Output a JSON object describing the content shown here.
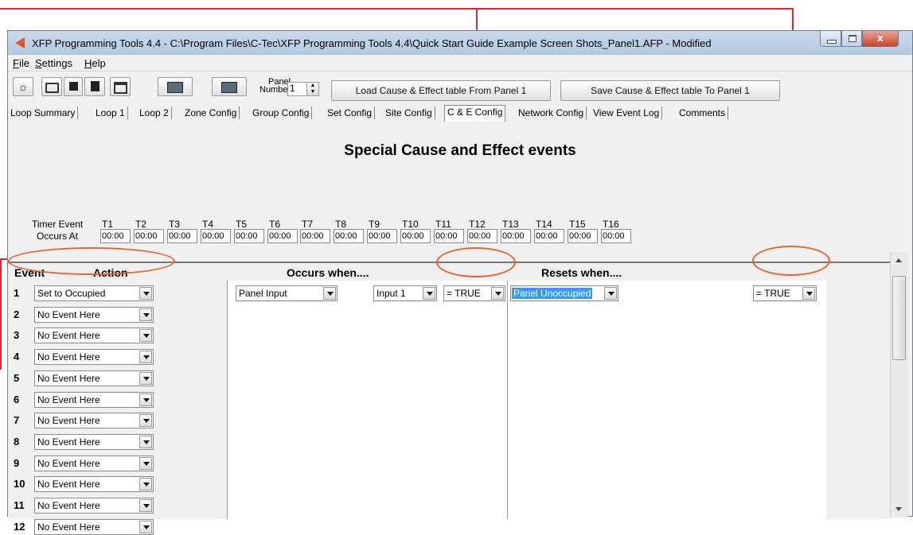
{
  "window": {
    "title": "XFP Programming Tools 4.4 - C:\\Program Files\\C-Tec\\XFP Programming Tools 4.4\\Quick Start Guide Example Screen Shots_Panel1.AFP - Modified",
    "close_glyph": "x"
  },
  "menu": [
    "File",
    "Settings",
    "Help"
  ],
  "toolbar": {
    "panel_label_line1": "Panel",
    "panel_label_line2": "Number",
    "panel_number": "1",
    "load_label": "Load Cause & Effect table From Panel 1",
    "save_label": "Save Cause & Effect table To Panel 1"
  },
  "tabs": [
    "Loop Summary",
    "Loop 1",
    "Loop 2",
    "Zone Config",
    "Group Config",
    "Set Config",
    "Site Config",
    "C & E Config",
    "Network Config",
    "View Event Log",
    "Comments"
  ],
  "active_tab": "C & E Config",
  "heading": "Special Cause and Effect events",
  "timers": {
    "row1_label": "Timer Event",
    "row2_label": "Occurs At",
    "names": [
      "T1",
      "T2",
      "T3",
      "T4",
      "T5",
      "T6",
      "T7",
      "T8",
      "T9",
      "T10",
      "T11",
      "T12",
      "T13",
      "T14",
      "T15",
      "T16"
    ],
    "times": [
      "00:00",
      "00:00",
      "00:00",
      "00:00",
      "00:00",
      "00:00",
      "00:00",
      "00:00",
      "00:00",
      "00:00",
      "00:00",
      "00:00",
      "00:00",
      "00:00",
      "00:00",
      "00:00"
    ]
  },
  "columns": {
    "event": "Event",
    "action": "Action",
    "occurs": "Occurs when....",
    "resets": "Resets when...."
  },
  "events": [
    {
      "num": "1",
      "action": "Set to Occupied"
    },
    {
      "num": "2",
      "action": "No Event Here"
    },
    {
      "num": "3",
      "action": "No Event Here"
    },
    {
      "num": "4",
      "action": "No Event Here"
    },
    {
      "num": "5",
      "action": "No Event Here"
    },
    {
      "num": "6",
      "action": "No Event Here"
    },
    {
      "num": "7",
      "action": "No Event Here"
    },
    {
      "num": "8",
      "action": "No Event Here"
    },
    {
      "num": "9",
      "action": "No Event Here"
    },
    {
      "num": "10",
      "action": "No Event Here"
    },
    {
      "num": "11",
      "action": "No Event Here"
    },
    {
      "num": "12",
      "action": "No Event Here"
    }
  ],
  "event1": {
    "occurs_source": "Panel Input",
    "occurs_input": "Input 1",
    "occurs_condition": "= TRUE",
    "resets_source": "Panel Unoccupied",
    "resets_condition": "= TRUE"
  },
  "colors": {
    "callout": "#e3262b",
    "highlight": "#3399ff"
  }
}
